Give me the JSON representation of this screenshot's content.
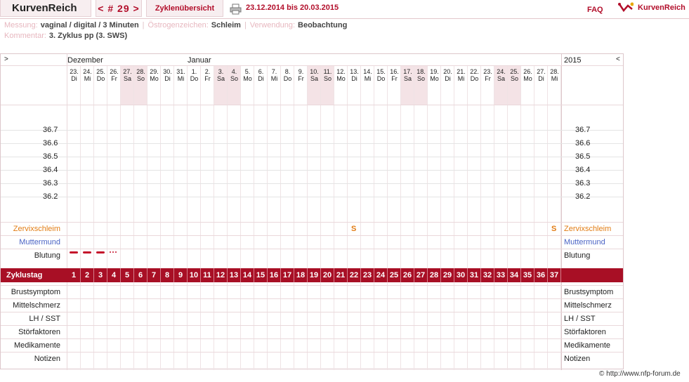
{
  "header": {
    "brand": "KurvenReich",
    "cycle_nav": "< # 29 >",
    "overview_tab": "Zyklenübersicht",
    "date_range": "23.12.2014 bis 20.03.2015",
    "faq": "FAQ",
    "logo_text": "KurvenReich"
  },
  "meta": {
    "measurement_label": "Messung:",
    "measurement_value": "vaginal / digital / 3 Minuten",
    "estrogen_label": "Östrogenzeichen:",
    "estrogen_value": "Schleim",
    "usage_label": "Verwendung:",
    "usage_value": "Beobachtung",
    "comment_label": "Kommentar:",
    "comment_value": "3. Zyklus pp (3. SWS)"
  },
  "chart": {
    "left_arrow": ">",
    "right_arrow": "<",
    "month_1": "Dezember",
    "month_2": "Januar",
    "year": "2015",
    "temperatures": [
      "36.7",
      "36.6",
      "36.5",
      "36.4",
      "36.3",
      "36.2"
    ],
    "days": [
      {
        "d": "23.",
        "w": "Di"
      },
      {
        "d": "24.",
        "w": "Mi"
      },
      {
        "d": "25.",
        "w": "Do"
      },
      {
        "d": "26.",
        "w": "Fr"
      },
      {
        "d": "27.",
        "w": "Sa"
      },
      {
        "d": "28.",
        "w": "So"
      },
      {
        "d": "29.",
        "w": "Mo"
      },
      {
        "d": "30.",
        "w": "Di"
      },
      {
        "d": "31.",
        "w": "Mi"
      },
      {
        "d": "1.",
        "w": "Do"
      },
      {
        "d": "2.",
        "w": "Fr"
      },
      {
        "d": "3.",
        "w": "Sa"
      },
      {
        "d": "4.",
        "w": "So"
      },
      {
        "d": "5.",
        "w": "Mo"
      },
      {
        "d": "6.",
        "w": "Di"
      },
      {
        "d": "7.",
        "w": "Mi"
      },
      {
        "d": "8.",
        "w": "Do"
      },
      {
        "d": "9.",
        "w": "Fr"
      },
      {
        "d": "10.",
        "w": "Sa"
      },
      {
        "d": "11.",
        "w": "So"
      },
      {
        "d": "12.",
        "w": "Mo"
      },
      {
        "d": "13.",
        "w": "Di"
      },
      {
        "d": "14.",
        "w": "Mi"
      },
      {
        "d": "15.",
        "w": "Do"
      },
      {
        "d": "16.",
        "w": "Fr"
      },
      {
        "d": "17.",
        "w": "Sa"
      },
      {
        "d": "18.",
        "w": "So"
      },
      {
        "d": "19.",
        "w": "Mo"
      },
      {
        "d": "20.",
        "w": "Di"
      },
      {
        "d": "21.",
        "w": "Mi"
      },
      {
        "d": "22.",
        "w": "Do"
      },
      {
        "d": "23.",
        "w": "Fr"
      },
      {
        "d": "24.",
        "w": "Sa"
      },
      {
        "d": "25.",
        "w": "So"
      },
      {
        "d": "26.",
        "w": "Mo"
      },
      {
        "d": "27.",
        "w": "Di"
      },
      {
        "d": "28.",
        "w": "Mi"
      }
    ],
    "weekend_indices": [
      4,
      5,
      11,
      12,
      18,
      19,
      25,
      26,
      32,
      33
    ],
    "mucus_label": "Zervixschleim",
    "cervix_label": "Muttermund",
    "bleeding_label": "Blutung",
    "mucus_marks": [
      {
        "day": 21,
        "symbol": "S"
      },
      {
        "day": 36,
        "symbol": "S"
      }
    ],
    "bleeding": [
      {
        "day": 0,
        "level": "heavy"
      },
      {
        "day": 1,
        "level": "heavy"
      },
      {
        "day": 2,
        "level": "heavy"
      },
      {
        "day": 3,
        "level": "spotting"
      }
    ],
    "cycle_day_label": "Zyklustag",
    "cycle_days": [
      "1",
      "2",
      "3",
      "4",
      "5",
      "6",
      "7",
      "8",
      "9",
      "10",
      "11",
      "12",
      "13",
      "14",
      "15",
      "16",
      "17",
      "18",
      "19",
      "20",
      "21",
      "22",
      "23",
      "24",
      "25",
      "26",
      "27",
      "28",
      "29",
      "30",
      "31",
      "32",
      "33",
      "34",
      "35",
      "36",
      "37"
    ],
    "extra_rows": [
      "Brustsymptom",
      "Mittelschmerz",
      "LH / SST",
      "Störfaktoren",
      "Medikamente",
      "Notizen"
    ]
  },
  "colors": {
    "accent": "#b20e2a",
    "mucus": "#e27c14",
    "cervix": "#4a63c4",
    "weekend": "#f4e3e6"
  },
  "footer": {
    "copyright": "© http://www.nfp-forum.de"
  }
}
